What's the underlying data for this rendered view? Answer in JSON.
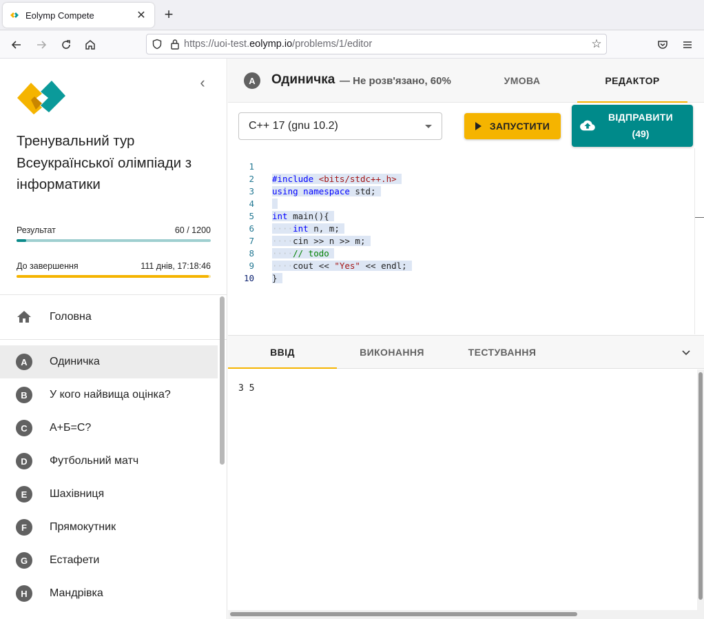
{
  "browser": {
    "tab_title": "Eolymp Compete",
    "url_prefix": "https://uoi-test.",
    "url_domain": "eolymp.io",
    "url_path": "/problems/1/editor"
  },
  "sidebar": {
    "contest_title": "Тренувальний тур Всеукраїнської олімпіади з інформатики",
    "result_label": "Результат",
    "result_value": "60 / 1200",
    "result_progress": 0.05,
    "time_label": "До завершення",
    "time_value": "111 днів, 17:18:46",
    "time_progress": 0.99,
    "home_label": "Головна",
    "problems": [
      {
        "letter": "A",
        "title": "Одиничка"
      },
      {
        "letter": "B",
        "title": "У кого найвища оцінка?"
      },
      {
        "letter": "C",
        "title": "А+Б=С?"
      },
      {
        "letter": "D",
        "title": "Футбольний матч"
      },
      {
        "letter": "E",
        "title": "Шахівниця"
      },
      {
        "letter": "F",
        "title": "Прямокутник"
      },
      {
        "letter": "G",
        "title": "Естафети"
      },
      {
        "letter": "H",
        "title": "Мандрівка"
      }
    ],
    "colors": {
      "result_bar": "#0b8a8a",
      "result_track": "#9fcfd0",
      "time_bar": "#f5b400"
    }
  },
  "problem": {
    "letter": "A",
    "title": "Одиничка",
    "status": "— Не розв'язано, 60%",
    "tab_statement": "УМОВА",
    "tab_editor": "РЕДАКТОР"
  },
  "toolbar": {
    "language": "C++ 17 (gnu 10.2)",
    "run_label": "ЗАПУСТИТИ",
    "submit_label": "ВІДПРАВИТИ",
    "submit_count": "(49)"
  },
  "editor": {
    "current_line": 10,
    "lines": [
      "#include <bits/stdc++.h>",
      "using namespace std;",
      "",
      "int main(){",
      "    int n, m;",
      "    cin >> n >> m;",
      "    // todo",
      "    cout << \"Yes\" << endl;",
      "}",
      ""
    ]
  },
  "io": {
    "tab_input": "ВВІД",
    "tab_run": "ВИКОНАННЯ",
    "tab_test": "ТЕСТУВАННЯ",
    "input_text": "3 5"
  }
}
